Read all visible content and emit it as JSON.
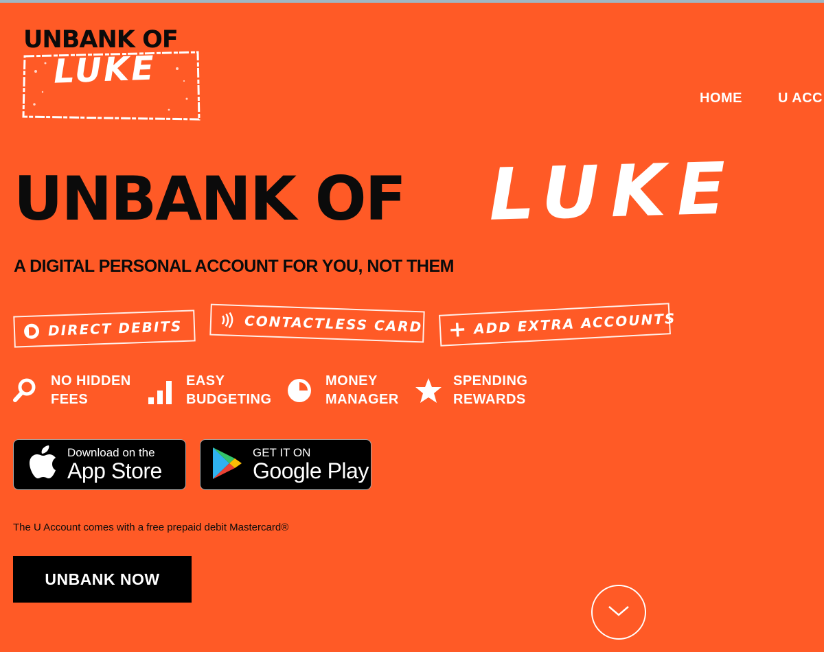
{
  "brand": {
    "logo_top": "UNBANK OF",
    "logo_script": "LUKE"
  },
  "nav": {
    "items": [
      "HOME",
      "U ACC"
    ]
  },
  "hero": {
    "title": "UNBANK OF",
    "title_script": "LUKE",
    "subtitle": "A DIGITAL PERSONAL ACCOUNT FOR YOU, NOT THEM"
  },
  "stamps": [
    {
      "label": "DIRECT DEBITS",
      "icon": "direct-debit-icon"
    },
    {
      "label": "CONTACTLESS CARD",
      "icon": "contactless-icon"
    },
    {
      "label": "ADD EXTRA ACCOUNTS",
      "icon": "plus-icon"
    }
  ],
  "features": [
    {
      "line1": "NO HIDDEN",
      "line2": "FEES",
      "icon": "magnifier-icon"
    },
    {
      "line1": "EASY",
      "line2": "BUDGETING",
      "icon": "bar-chart-icon"
    },
    {
      "line1": "MONEY",
      "line2": "MANAGER",
      "icon": "pie-chart-icon"
    },
    {
      "line1": "SPENDING",
      "line2": "REWARDS",
      "icon": "star-icon"
    }
  ],
  "badges": {
    "apple": {
      "small": "Download on the",
      "big": "App Store"
    },
    "google": {
      "small": "GET IT ON",
      "big": "Google Play"
    }
  },
  "note": "The U Account comes with a free prepaid debit Mastercard®",
  "cta": "UNBANK NOW",
  "colors": {
    "background": "#FF5A26",
    "text_dark": "#0b0b0b",
    "text_light": "#ffffff"
  }
}
